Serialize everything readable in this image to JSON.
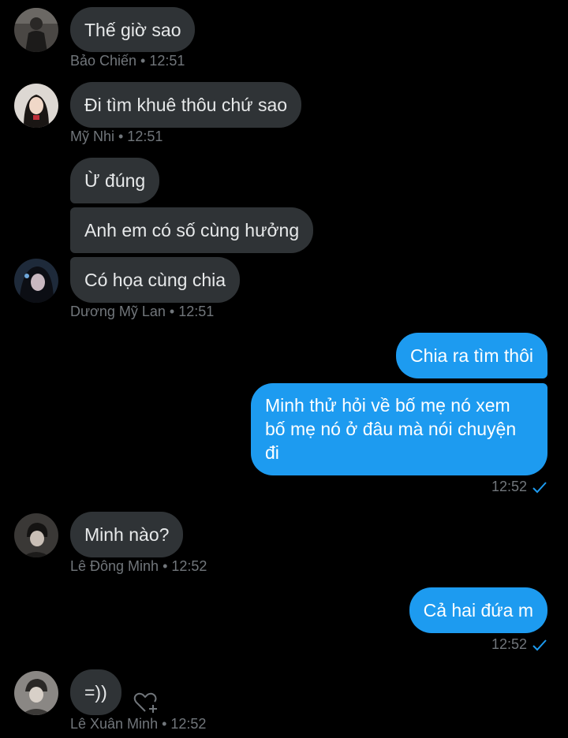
{
  "messages": [
    {
      "text": "Thế giờ sao",
      "sender": "Bảo Chiến",
      "time": "12:51"
    },
    {
      "text": "Đi tìm khuê thôu chứ sao",
      "sender": "Mỹ Nhi",
      "time": "12:51"
    },
    {
      "text": "Ừ đúng"
    },
    {
      "text": "Anh em có số cùng hưởng"
    },
    {
      "text": "Có họa cùng chia",
      "sender": "Dương Mỹ Lan",
      "time": "12:51"
    },
    {
      "text": "Chia ra tìm thôi"
    },
    {
      "text": "Minh thử hỏi về bố mẹ nó xem bố mẹ nó ở đâu mà nói chuyện đi",
      "time": "12:52"
    },
    {
      "text": "Minh nào?",
      "sender": "Lê Đông Minh",
      "time": "12:52"
    },
    {
      "text": "Cả hai đứa m",
      "time": "12:52"
    },
    {
      "text": "=))",
      "sender": "Lê Xuân Minh",
      "time": "12:52"
    }
  ],
  "meta": {
    "m0": "Bảo Chiến • 12:51",
    "m1": "Mỹ Nhi • 12:51",
    "m4": "Dương Mỹ Lan • 12:51",
    "m7": "Lê Đông Minh • 12:52",
    "m9": "Lê Xuân Minh • 12:52"
  },
  "colors": {
    "background": "#000000",
    "incoming_bubble": "#2f3336",
    "outgoing_bubble": "#1d9bf0",
    "meta_text": "#71767b",
    "read_check": "#1d9bf0"
  },
  "icons": {
    "read_receipt": "check-icon",
    "react": "heart-plus-icon"
  }
}
